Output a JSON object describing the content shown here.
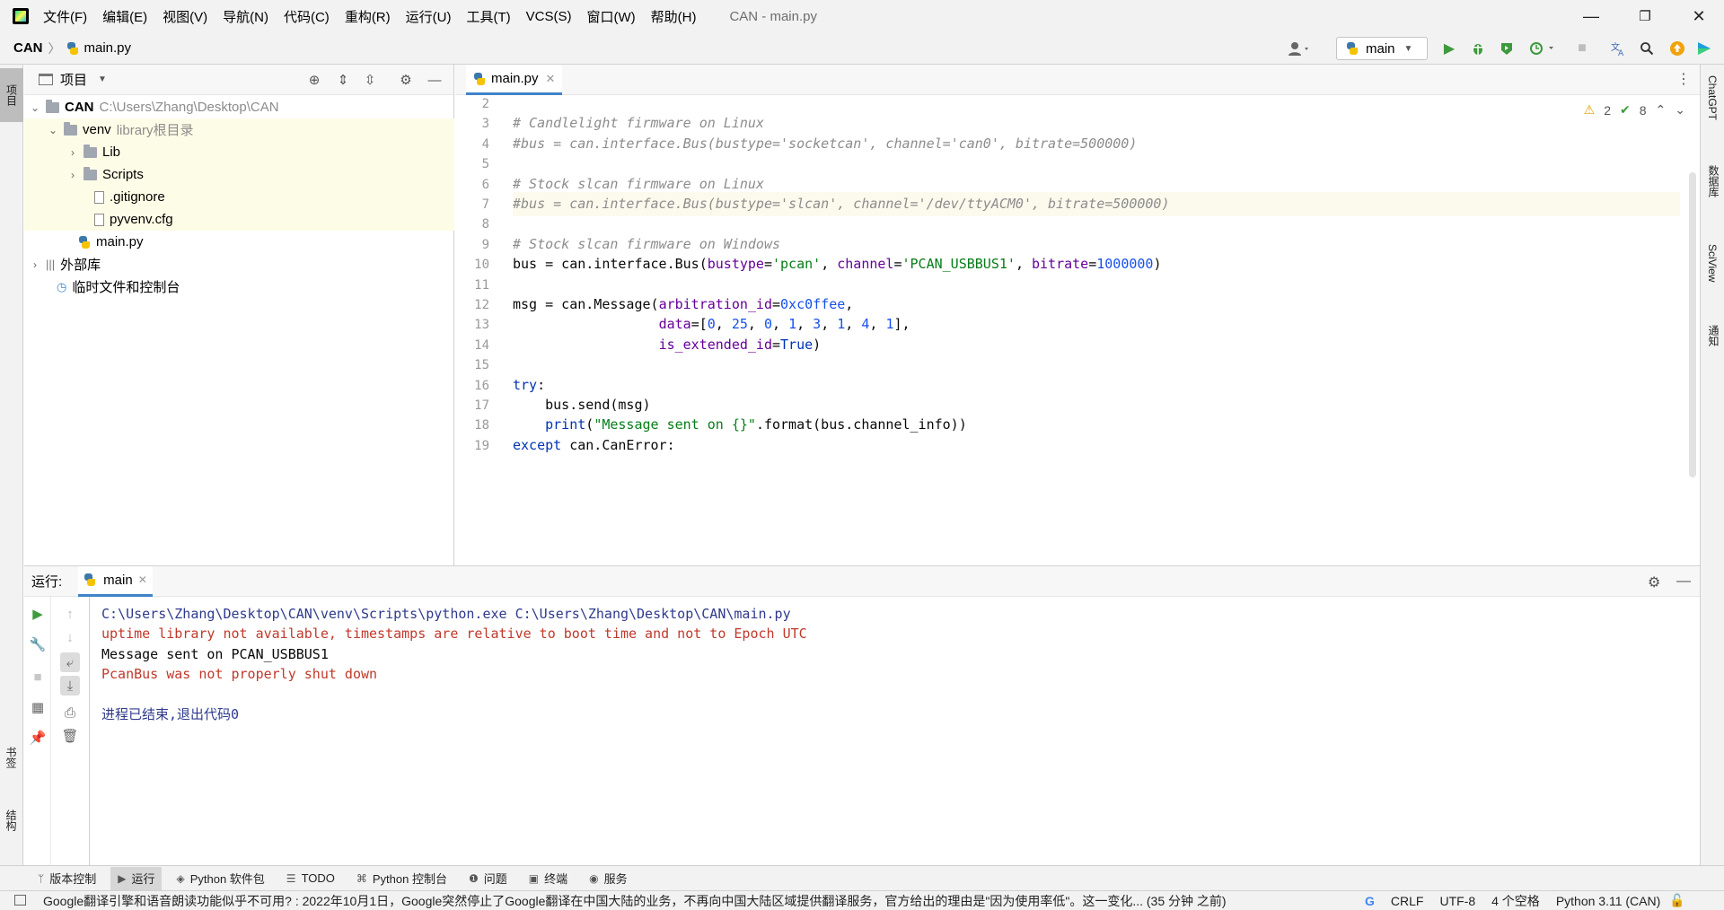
{
  "window": {
    "title": "CAN - main.py",
    "minimize": "—",
    "restore": "❐",
    "close": "✕"
  },
  "menu": [
    "文件(F)",
    "编辑(E)",
    "视图(V)",
    "导航(N)",
    "代码(C)",
    "重构(R)",
    "运行(U)",
    "工具(T)",
    "VCS(S)",
    "窗口(W)",
    "帮助(H)"
  ],
  "breadcrumb": {
    "project": "CAN",
    "file": "main.py"
  },
  "run_config": {
    "name": "main"
  },
  "left_stripe": {
    "project": "项目",
    "bookmarks": "书签",
    "structure": "结构"
  },
  "right_stripe": [
    "ChatGPT",
    "数据库",
    "SciView",
    "通知"
  ],
  "project_panel": {
    "title": "项目",
    "tree": [
      {
        "name": "CAN",
        "hint": "C:\\Users\\Zhang\\Desktop\\CAN",
        "kind": "folder",
        "expanded": true
      },
      {
        "name": "venv",
        "hint": "library根目录",
        "kind": "folder",
        "expanded": true
      },
      {
        "name": "Lib",
        "hint": "",
        "kind": "folder",
        "expanded": false
      },
      {
        "name": "Scripts",
        "hint": "",
        "kind": "folder",
        "expanded": false
      },
      {
        "name": ".gitignore",
        "hint": "",
        "kind": "file"
      },
      {
        "name": "pyvenv.cfg",
        "hint": "",
        "kind": "file"
      },
      {
        "name": "main.py",
        "hint": "",
        "kind": "python"
      },
      {
        "name": "外部库",
        "hint": "",
        "kind": "library",
        "expanded": false
      },
      {
        "name": "临时文件和控制台",
        "hint": "",
        "kind": "scratch"
      }
    ]
  },
  "editor": {
    "tab": "main.py",
    "inspections": {
      "warnings": "2",
      "ok": "8"
    },
    "line_numbers": [
      "2",
      "3",
      "4",
      "5",
      "6",
      "7",
      "8",
      "9",
      "10",
      "11",
      "12",
      "13",
      "14",
      "15",
      "16",
      "17",
      "18",
      "19"
    ],
    "code": [
      "",
      "# Candlelight firmware on Linux",
      "#bus = can.interface.Bus(bustype='socketcan', channel='can0', bitrate=500000)",
      "",
      "# Stock slcan firmware on Linux",
      "#bus = can.interface.Bus(bustype='slcan', channel='/dev/ttyACM0', bitrate=500000)",
      "",
      "# Stock slcan firmware on Windows",
      "bus = can.interface.Bus(bustype='pcan', channel='PCAN_USBBUS1', bitrate=1000000)",
      "",
      "msg = can.Message(arbitration_id=0xc0ffee,",
      "                  data=[0, 25, 0, 1, 3, 1, 4, 1],",
      "                  is_extended_id=True)",
      "",
      "try:",
      "    bus.send(msg)",
      "    print(\"Message sent on {}\".format(bus.channel_info))",
      "except can.CanError:"
    ]
  },
  "run_panel": {
    "label": "运行:",
    "tab": "main",
    "console": [
      {
        "kind": "cmd",
        "text": "C:\\Users\\Zhang\\Desktop\\CAN\\venv\\Scripts\\python.exe C:\\Users\\Zhang\\Desktop\\CAN\\main.py"
      },
      {
        "kind": "err",
        "text": "uptime library not available, timestamps are relative to boot time and not to Epoch UTC"
      },
      {
        "kind": "out",
        "text": "Message sent on PCAN_USBBUS1"
      },
      {
        "kind": "err",
        "text": "PcanBus was not properly shut down"
      },
      {
        "kind": "out",
        "text": ""
      },
      {
        "kind": "exit",
        "text": "进程已结束,退出代码0"
      }
    ]
  },
  "bottom_tools": [
    {
      "label": "版本控制",
      "icon": "branch-icon"
    },
    {
      "label": "运行",
      "icon": "play-icon",
      "active": true
    },
    {
      "label": "Python 软件包",
      "icon": "package-icon"
    },
    {
      "label": "TODO",
      "icon": "list-icon"
    },
    {
      "label": "Python 控制台",
      "icon": "console-icon"
    },
    {
      "label": "问题",
      "icon": "info-icon"
    },
    {
      "label": "终端",
      "icon": "terminal-icon"
    },
    {
      "label": "服务",
      "icon": "services-icon"
    }
  ],
  "status": {
    "message": "Google翻译引擎和语音朗读功能似乎不可用? : 2022年10月1日，Google突然停止了Google翻译在中国大陆的业务，不再向中国大陆区域提供翻译服务，官方给出的理由是\"因为使用率低\"。这一变化... (35 分钟 之前)",
    "line_sep": "CRLF",
    "encoding": "UTF-8",
    "indent": "4 个空格",
    "interpreter": "Python 3.11 (CAN)"
  },
  "colors": {
    "accent": "#4083c9",
    "comment": "#8c8c8c",
    "string": "#067d17",
    "number": "#1750eb",
    "keyword": "#0033b3",
    "error": "#c0392b"
  }
}
